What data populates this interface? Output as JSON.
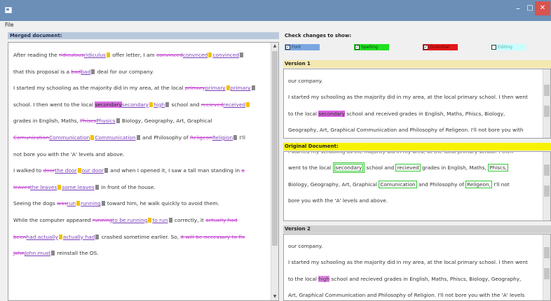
{
  "window": {
    "minimize_glyph": "–",
    "maximize_glyph": "□",
    "close_glyph": "✕"
  },
  "menu": {
    "file": "File"
  },
  "merged": {
    "header": "Merged document:",
    "l1": {
      "a": "After reading the ",
      "del1": "ridiculous",
      "ins1": "ridiculus",
      "b": " offer letter, I am ",
      "del2": "convinced",
      "ins2": "convnced",
      "ins3": "convinced"
    },
    "l2": {
      "a": "that this proposal is a ",
      "del1": "bad",
      "ins1": "bad",
      "b": " deal for our company."
    },
    "l3": {
      "a": "I started my schooling as the majority did in my area, at the local ",
      "del1": "primary",
      "ins1": "primary",
      "ins2": "primary"
    },
    "l4": {
      "a": "school. I then went to the local ",
      "hl1": "secondary",
      "ins1": "secondary",
      "ins2": "high",
      "b": " school and ",
      "del1": "recieved",
      "ins3": "received"
    },
    "l5": {
      "a": "grades in English, Maths, ",
      "del1": "Phiscs",
      "ins1": "Physics",
      "b": " Biology, Geography, Art, Graphical"
    },
    "l6": {
      "del1": "Comunication",
      "ins1": "Communication",
      "ins2": "Communication",
      "a": " and Philosophy of ",
      "del2": "Religeon",
      "ins3": "Religion",
      "b": " I'll"
    },
    "l7": {
      "a": "not bore you with the 'A' levels and above."
    },
    "l8": {
      "a": "I walked to ",
      "del1": "door",
      "ins1": "the door",
      "ins2": "our door",
      "b": " and when I opened it, I saw a tall man standing in ",
      "del2": "a"
    },
    "l9": {
      "del1": "leaves",
      "ins1": "the leaves",
      "ins2": "some leaves",
      "a": " in front of the house."
    },
    "l10": {
      "a": "Seeing the dogs ",
      "del1": "was",
      "ins1": "run",
      "ins2": "running",
      "b": " toward him, he walk quickly to avoid them."
    },
    "l11": {
      "a": "While the computer appeared ",
      "del1": "running",
      "ins1": "to be running",
      "ins2": "to run",
      "b": " correctly, it ",
      "del2": "actually had"
    },
    "l12": {
      "del1": "been",
      "ins1": "had actually",
      "ins2": "actually had",
      "a": " crashed sometime earlier. So, ",
      "del2": "it will be necessary to fix"
    },
    "l13": {
      "del1": "John",
      "ins1": "John must",
      "a": " reinstall the OS."
    }
  },
  "check": {
    "title": "Check changes to show:",
    "font": "Font",
    "spelling": "Spelling",
    "grammar": "Grammar",
    "editing": "Editing",
    "tick": "✓"
  },
  "version1": {
    "header": "Version 1",
    "p1": "our company.",
    "p2": "I started my schooling as the majority did in my area, at the local primary school. I then went",
    "p3a": "to the local ",
    "p3hl": "secondary",
    "p3b": " school and received grades in English, Maths, Phiscs, Biology,",
    "p4": "Geography, Art, Graphical Communication and Philosophy of Religeon. I'll not bore you with"
  },
  "original": {
    "header": "Original Document:",
    "p0": "I started my schooling as the majority did in my area, at the local primary school. I then",
    "p1a": "went to the local ",
    "p1b": "secondary",
    "p1c": " school and ",
    "p1d": "recieved",
    "p1e": " grades in English, Maths, ",
    "p1f": "Phiscs,",
    "p2a": "Biology, Geography, Art, Graphical ",
    "p2b": "Comunication",
    "p2c": " and Philosophy of ",
    "p2d": "Religeon,",
    "p2e": " I'll not",
    "p3": "bore you with the 'A' levels and above."
  },
  "version2": {
    "header": "Version 2",
    "p1": "our company.",
    "p2": "I started my schooling as the majority did in my area, at the local primary school. I then went",
    "p3a": "to the local ",
    "p3hl": "high",
    "p3b": " school and recieved grades in English, Maths, Phiscs, Biology, Geography,",
    "p4": "Art, Graphical Communication and Philosophy of Religion. I'll not bore you with the 'A' levels"
  }
}
